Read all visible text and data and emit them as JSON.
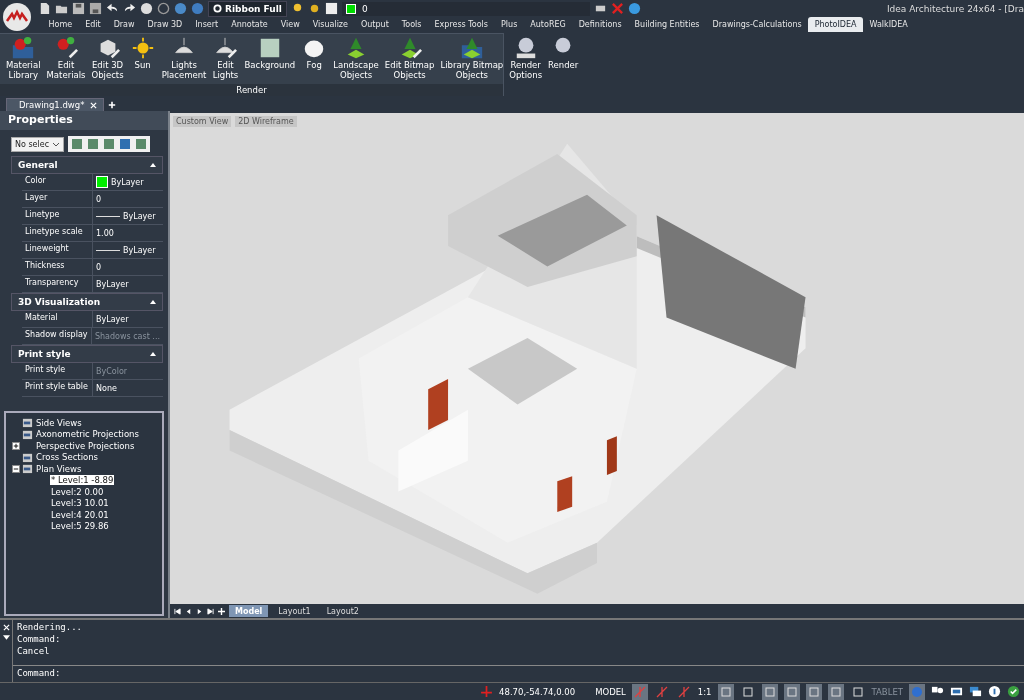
{
  "title_bar": {
    "ribbon_mode": "Ribbon Full",
    "layer": "0",
    "title": "Idea Architecture 24x64  - [Dra"
  },
  "ribbon_tabs": [
    {
      "label": "Home",
      "selected": false
    },
    {
      "label": "Edit",
      "selected": false
    },
    {
      "label": "Draw",
      "selected": false
    },
    {
      "label": "Draw 3D",
      "selected": false
    },
    {
      "label": "Insert",
      "selected": false
    },
    {
      "label": "Annotate",
      "selected": false
    },
    {
      "label": "View",
      "selected": false
    },
    {
      "label": "Visualize",
      "selected": false
    },
    {
      "label": "Output",
      "selected": false
    },
    {
      "label": "Tools",
      "selected": false
    },
    {
      "label": "Express Tools",
      "selected": false
    },
    {
      "label": "Plus",
      "selected": false
    },
    {
      "label": "AutoREG",
      "selected": false
    },
    {
      "label": "Definitions",
      "selected": false
    },
    {
      "label": "Building Entities",
      "selected": false
    },
    {
      "label": "Drawings-Calculations",
      "selected": false
    },
    {
      "label": "PhotoIDEA",
      "selected": true
    },
    {
      "label": "WalkIDEA",
      "selected": false
    }
  ],
  "ribbon_panel": {
    "group": "Render",
    "buttons": [
      {
        "lines": [
          "Material",
          "Library"
        ]
      },
      {
        "lines": [
          "Edit",
          "Materials"
        ]
      },
      {
        "lines": [
          "Edit 3D",
          "Objects"
        ]
      },
      {
        "lines": [
          "Sun"
        ]
      },
      {
        "lines": [
          "Lights",
          "Placement"
        ]
      },
      {
        "lines": [
          "Edit",
          "Lights"
        ]
      },
      {
        "lines": [
          "Background"
        ]
      },
      {
        "lines": [
          "Fog"
        ]
      },
      {
        "lines": [
          "Landscape",
          "Objects"
        ]
      },
      {
        "lines": [
          "Edit Bitmap",
          "Objects"
        ]
      },
      {
        "lines": [
          "Library Bitmap",
          "Objects"
        ]
      },
      {
        "lines": [
          "Render",
          "Options"
        ]
      },
      {
        "lines": [
          "Render"
        ]
      }
    ]
  },
  "doc_tabs": [
    {
      "label": "Drawing1.dwg*",
      "selected": true
    }
  ],
  "properties": {
    "title": "Properties",
    "selection": "No selec",
    "sections": [
      {
        "title": "General",
        "expanded": true,
        "rows": [
          {
            "name": "Color",
            "value": "ByLayer",
            "kind": "color",
            "color": "#00ee00",
            "disabled": false
          },
          {
            "name": "Layer",
            "value": "0",
            "kind": "text",
            "disabled": false
          },
          {
            "name": "Linetype",
            "value": "ByLayer",
            "kind": "line",
            "disabled": false
          },
          {
            "name": "Linetype scale",
            "value": "1.00",
            "kind": "text",
            "disabled": false
          },
          {
            "name": "Lineweight",
            "value": "ByLayer",
            "kind": "line",
            "disabled": false
          },
          {
            "name": "Thickness",
            "value": "0",
            "kind": "text",
            "disabled": false
          },
          {
            "name": "Transparency",
            "value": "ByLayer",
            "kind": "text",
            "disabled": false
          }
        ]
      },
      {
        "title": "3D Visualization",
        "expanded": true,
        "rows": [
          {
            "name": "Material",
            "value": "ByLayer",
            "kind": "text",
            "disabled": false
          },
          {
            "name": "Shadow display",
            "value": "Shadows cast ...",
            "kind": "text",
            "disabled": true
          }
        ]
      },
      {
        "title": "Print style",
        "expanded": true,
        "rows": [
          {
            "name": "Print style",
            "value": "ByColor",
            "kind": "text",
            "disabled": true
          },
          {
            "name": "Print style table",
            "value": "None",
            "kind": "text",
            "disabled": false
          }
        ]
      }
    ]
  },
  "tree": [
    {
      "label": "Side Views",
      "kind": "leaf"
    },
    {
      "label": "Axonometric Projections",
      "kind": "leaf"
    },
    {
      "label": "Perspective Projections",
      "kind": "folder",
      "expanded": false
    },
    {
      "label": "Cross Sections",
      "kind": "leaf"
    },
    {
      "label": "Plan Views",
      "kind": "folder",
      "expanded": true,
      "children": [
        {
          "label": "* Level:1  -8.89",
          "selected": true
        },
        {
          "label": "Level:2  0.00",
          "selected": false
        },
        {
          "label": "Level:3  10.01",
          "selected": false
        },
        {
          "label": "Level:4  20.01",
          "selected": false
        },
        {
          "label": "Level:5  29.86",
          "selected": false
        }
      ]
    }
  ],
  "viewport": {
    "view": "Custom View",
    "style": "2D Wireframe"
  },
  "layout_tabs": [
    {
      "label": "Model",
      "selected": true
    },
    {
      "label": "Layout1",
      "selected": false
    },
    {
      "label": "Layout2",
      "selected": false
    }
  ],
  "command": {
    "history": [
      "Rendering...",
      "Command:",
      "Cancel"
    ],
    "prompt": "Command:"
  },
  "status_bar": {
    "coordinates": "48.70,-54.74,0.00",
    "space": "MODEL",
    "scale": "1:1",
    "tablet": "TABLET",
    "toggles": [
      {
        "on": true
      },
      {
        "on": false
      },
      {
        "on": false
      },
      {
        "on": true
      },
      {
        "on": false
      },
      {
        "on": true
      },
      {
        "on": true
      },
      {
        "on": true
      },
      {
        "on": true
      },
      {
        "on": false
      },
      {
        "on": true
      }
    ]
  }
}
